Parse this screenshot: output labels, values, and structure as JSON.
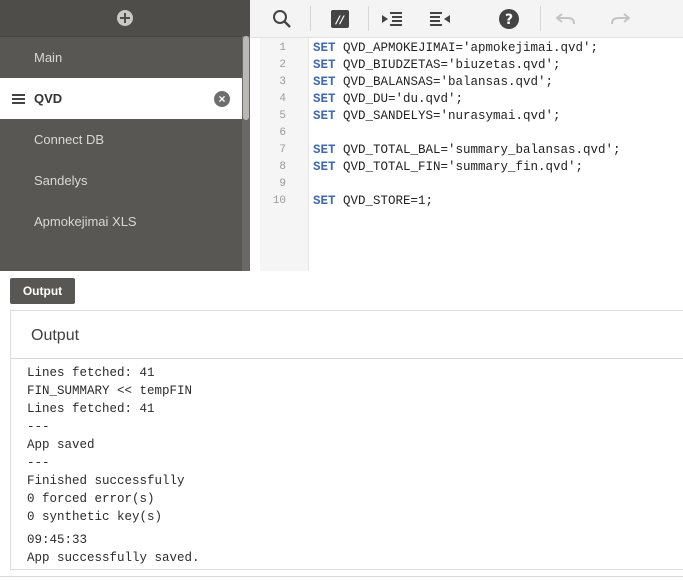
{
  "sidebar": {
    "sections": [
      {
        "label": "Main",
        "active": false
      },
      {
        "label": "QVD",
        "active": true
      },
      {
        "label": "Connect DB",
        "active": false
      },
      {
        "label": "Sandelys",
        "active": false
      },
      {
        "label": "Apmokejimai XLS",
        "active": false
      }
    ]
  },
  "toolbar": {
    "icons": [
      "search-icon",
      "comment-icon",
      "indent-icon",
      "outdent-icon",
      "help-icon",
      "undo-icon",
      "redo-icon"
    ]
  },
  "editor": {
    "lines": [
      {
        "n": "1",
        "kw": "SET",
        "rest": " QVD_APMOKEJIMAI='apmokejimai.qvd';"
      },
      {
        "n": "2",
        "kw": "SET",
        "rest": " QVD_BIUDZETAS='biuzetas.qvd';"
      },
      {
        "n": "3",
        "kw": "SET",
        "rest": " QVD_BALANSAS='balansas.qvd';"
      },
      {
        "n": "4",
        "kw": "SET",
        "rest": " QVD_DU='du.qvd';"
      },
      {
        "n": "5",
        "kw": "SET",
        "rest": " QVD_SANDELYS='nurasymai.qvd';"
      },
      {
        "n": "6",
        "kw": "",
        "rest": ""
      },
      {
        "n": "7",
        "kw": "SET",
        "rest": " QVD_TOTAL_BAL='summary_balansas.qvd';"
      },
      {
        "n": "8",
        "kw": "SET",
        "rest": " QVD_TOTAL_FIN='summary_fin.qvd';"
      },
      {
        "n": "9",
        "kw": "",
        "rest": ""
      },
      {
        "n": "10",
        "kw": "SET",
        "rest": " QVD_STORE=1;"
      }
    ]
  },
  "output": {
    "tab_label": "Output",
    "title": "Output",
    "log": [
      "Lines fetched: 41",
      "FIN_SUMMARY << tempFIN",
      "Lines fetched: 41",
      "---",
      "App saved",
      "---",
      "Finished successfully",
      "0 forced error(s)",
      "0 synthetic key(s)",
      "09:45:33",
      "App successfully saved."
    ]
  }
}
